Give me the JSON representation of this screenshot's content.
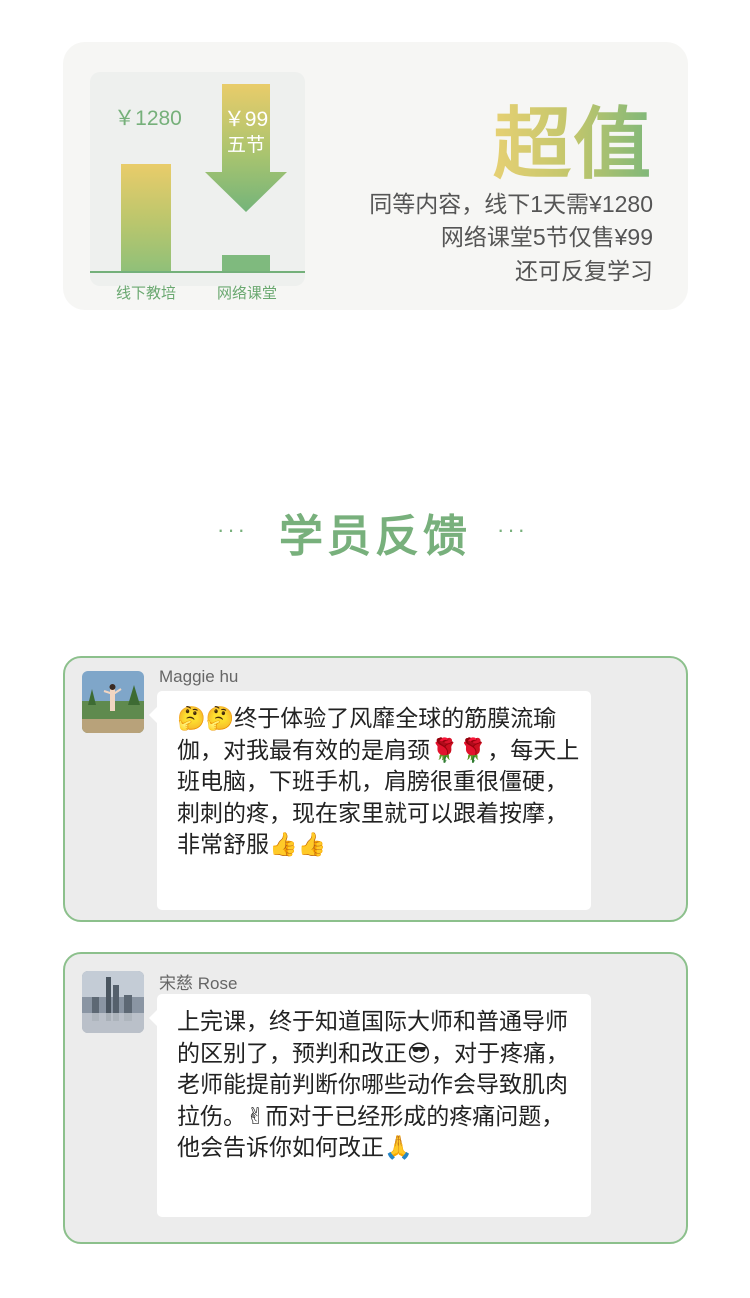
{
  "value_card": {
    "chart": {
      "offline_price": "￥1280",
      "online_price": "￥99",
      "online_sessions": "五节",
      "offline_label": "线下教培",
      "online_label": "网络课堂"
    },
    "headline": "超值",
    "desc_line1": "同等内容，线下1天需¥1280",
    "desc_line2": "网络课堂5节仅售¥99",
    "desc_line3": "还可反复学习"
  },
  "section": {
    "title": "学员反馈",
    "dots": "···"
  },
  "feedback": [
    {
      "name": "Maggie hu",
      "message": "🤔🤔终于体验了风靡全球的筋膜流瑜伽，对我最有效的是肩颈🌹🌹，每天上班电脑，下班手机，肩膀很重很僵硬，刺刺的疼，现在家里就可以跟着按摩，非常舒服👍👍"
    },
    {
      "name": "宋慈 Rose",
      "message": "上完课，终于知道国际大师和普通导师的区别了，预判和改正😎，对于疼痛，老师能提前判断你哪些动作会导致肌肉拉伤。✌而对于已经形成的疼痛问题，他会告诉你如何改正🙏"
    }
  ],
  "colors": {
    "accent_green": "#78b07c",
    "gold": "#e6d073",
    "card_border": "#8cc08c"
  }
}
